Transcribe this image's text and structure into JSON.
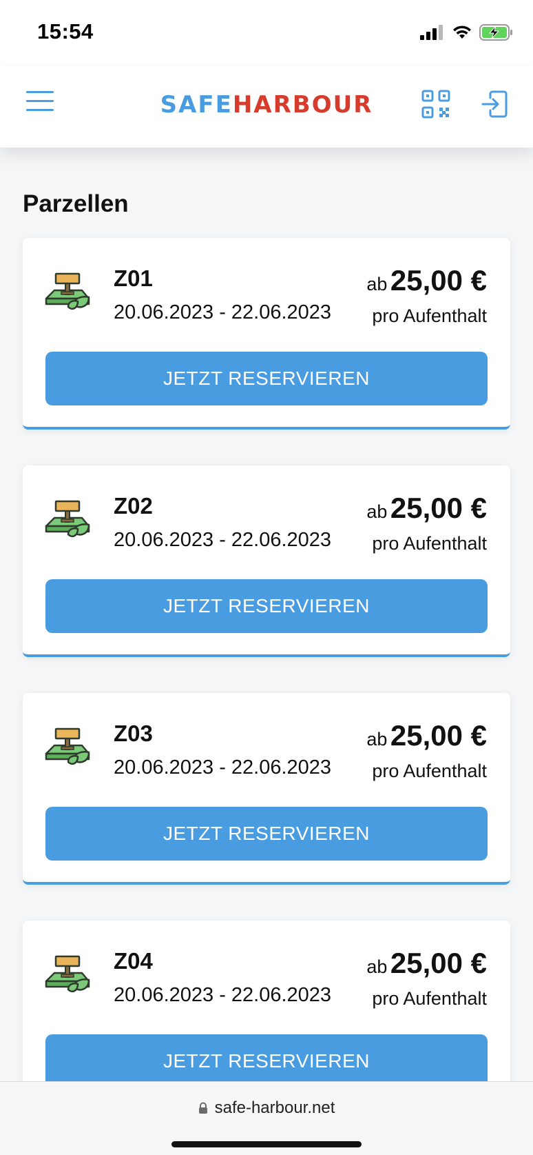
{
  "status_bar": {
    "time": "15:54",
    "icons": [
      "cellular-signal-icon",
      "wifi-icon",
      "battery-charging-icon"
    ]
  },
  "header": {
    "logo_part1": "SAFE",
    "logo_part2": "HARBOUR",
    "icons": [
      "menu-icon",
      "qr-code-icon",
      "login-icon"
    ],
    "colors": {
      "brand_blue": "#4a9ce0",
      "brand_red": "#d63b2c"
    }
  },
  "main": {
    "title": "Parzellen",
    "cards": [
      {
        "name": "Z01",
        "dates": "20.06.2023 - 22.06.2023",
        "price_prefix": "ab",
        "price": "25,00 €",
        "price_unit": "pro Aufenthalt",
        "button_label": "JETZT RESERVIEREN"
      },
      {
        "name": "Z02",
        "dates": "20.06.2023 - 22.06.2023",
        "price_prefix": "ab",
        "price": "25,00 €",
        "price_unit": "pro Aufenthalt",
        "button_label": "JETZT RESERVIEREN"
      },
      {
        "name": "Z03",
        "dates": "20.06.2023 - 22.06.2023",
        "price_prefix": "ab",
        "price": "25,00 €",
        "price_unit": "pro Aufenthalt",
        "button_label": "JETZT RESERVIEREN"
      },
      {
        "name": "Z04",
        "dates": "20.06.2023 - 22.06.2023",
        "price_prefix": "ab",
        "price": "25,00 €",
        "price_unit": "pro Aufenthalt",
        "button_label": "JETZT RESERVIEREN"
      }
    ]
  },
  "browser": {
    "url": "safe-harbour.net"
  }
}
